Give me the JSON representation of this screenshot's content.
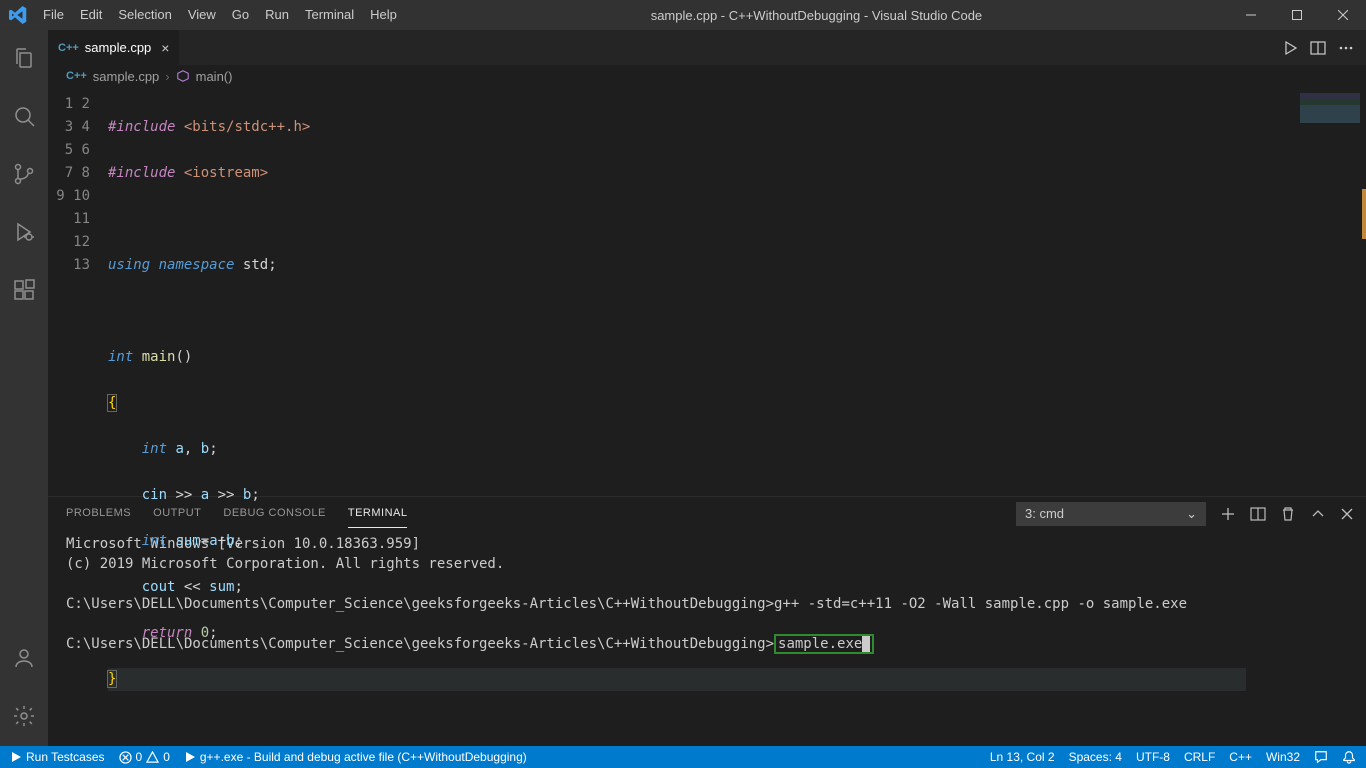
{
  "window": {
    "title": "sample.cpp - C++WithoutDebugging - Visual Studio Code"
  },
  "menu": [
    "File",
    "Edit",
    "Selection",
    "View",
    "Go",
    "Run",
    "Terminal",
    "Help"
  ],
  "tabs": [
    {
      "label": "sample.cpp"
    }
  ],
  "breadcrumbs": {
    "file": "sample.cpp",
    "symbol": "main()"
  },
  "code_lines": 13,
  "panel": {
    "tabs": [
      "PROBLEMS",
      "OUTPUT",
      "DEBUG CONSOLE",
      "TERMINAL"
    ],
    "active_tab": "TERMINAL",
    "terminal_select": "3: cmd",
    "terminal": {
      "l1": "Microsoft Windows [Version 10.0.18363.959]",
      "l2": "(c) 2019 Microsoft Corporation. All rights reserved.",
      "l3": "C:\\Users\\DELL\\Documents\\Computer_Science\\geeksforgeeks-Articles\\C++WithoutDebugging>g++ -std=c++11 -O2 -Wall sample.cpp -o sample.exe",
      "l4_prompt": "C:\\Users\\DELL\\Documents\\Computer_Science\\geeksforgeeks-Articles\\C++WithoutDebugging>",
      "l4_cmd": "sample.exe"
    }
  },
  "status": {
    "run_testcases": "Run Testcases",
    "errors": "0",
    "warnings": "0",
    "build_task": "g++.exe - Build and debug active file (C++WithoutDebugging)",
    "cursor": "Ln 13, Col 2",
    "spaces": "Spaces: 4",
    "encoding": "UTF-8",
    "eol": "CRLF",
    "lang": "C++",
    "platform": "Win32"
  }
}
